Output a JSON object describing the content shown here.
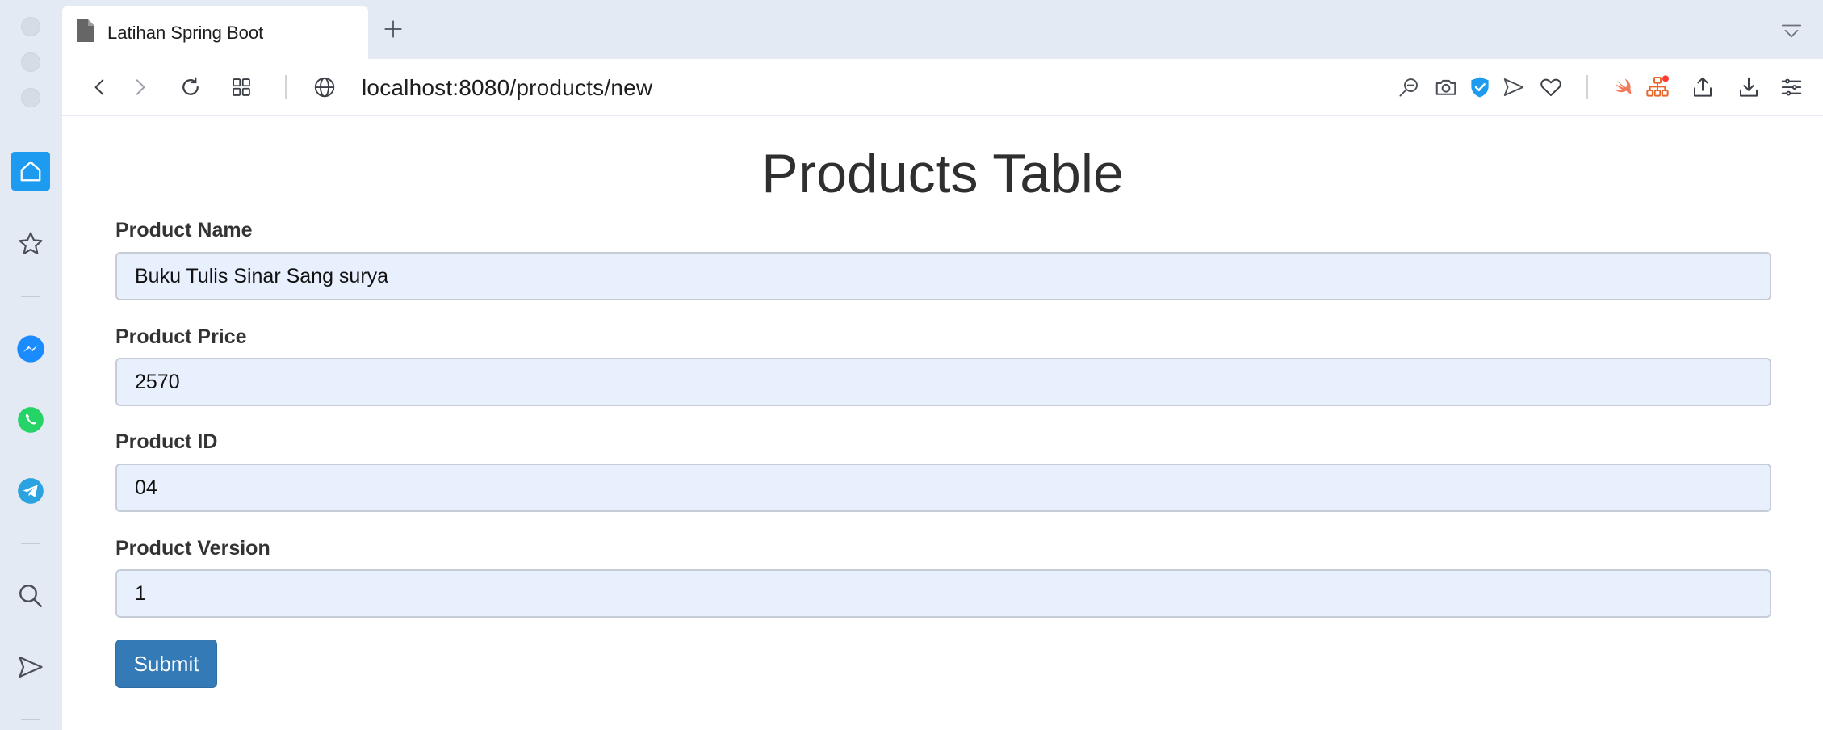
{
  "browser": {
    "tab_title": "Latihan Spring Boot",
    "url": "localhost:8080/products/new"
  },
  "page": {
    "heading": "Products Table",
    "fields": [
      {
        "label": "Product Name",
        "value": "Buku Tulis Sinar Sang surya"
      },
      {
        "label": "Product Price",
        "value": "2570"
      },
      {
        "label": "Product ID",
        "value": "04"
      },
      {
        "label": "Product Version",
        "value": "1"
      }
    ],
    "submit_label": "Submit"
  },
  "icons": {
    "sidebar": [
      "home-icon",
      "star-icon",
      "messenger-icon",
      "whatsapp-icon",
      "telegram-icon",
      "search-icon",
      "send-icon"
    ],
    "toolbar": [
      "back-icon",
      "forward-icon",
      "reload-icon",
      "tab-grid-icon",
      "globe-icon",
      "zoom-out-icon",
      "camera-icon",
      "shield-icon",
      "send-icon",
      "heart-icon",
      "swift-icon",
      "sitemap-icon",
      "share-icon",
      "download-icon",
      "menu-icon"
    ]
  },
  "colors": {
    "accent": "#1d9bf0",
    "submit": "#337ab7",
    "input_bg": "#e8f0fe"
  }
}
